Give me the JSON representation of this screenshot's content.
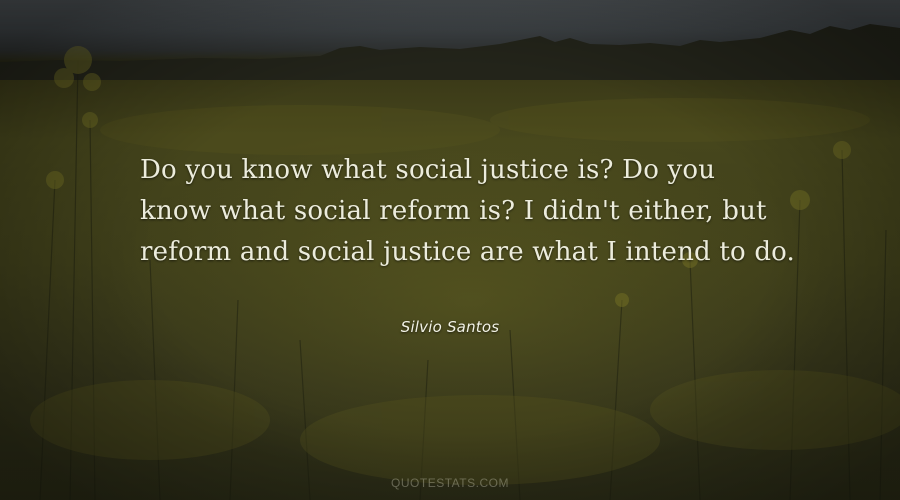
{
  "quote": {
    "lines": [
      "Do you know what social justice is? Do you",
      "know what social reform is? I didn't either, but",
      "reform and social justice are what I intend to do."
    ]
  },
  "author": "Silvio Santos",
  "watermark": "QUOTESTATS.COM",
  "colors": {
    "sky": "#3d4245",
    "field": "#46461c",
    "text": "#ececdc"
  }
}
